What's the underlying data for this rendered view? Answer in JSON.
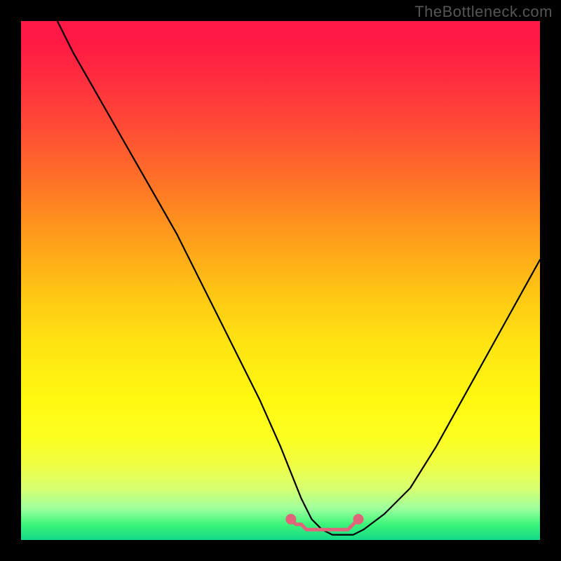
{
  "watermark": "TheBottleneck.com",
  "chart_data": {
    "type": "line",
    "title": "",
    "xlabel": "",
    "ylabel": "",
    "xlim": [
      0,
      100
    ],
    "ylim": [
      0,
      100
    ],
    "note": "Gradient heat background (red high → green low) with a V-shaped black curve. There is a small pink squiggle highlight at the bottom of the V.",
    "series": [
      {
        "name": "curve",
        "x": [
          7,
          10,
          14,
          18,
          22,
          26,
          30,
          34,
          38,
          42,
          46,
          50,
          52,
          54,
          56,
          58,
          60,
          62,
          64,
          66,
          70,
          75,
          80,
          85,
          90,
          95,
          100
        ],
        "values": [
          100,
          94,
          87,
          80,
          73,
          66,
          59,
          51,
          43,
          35,
          27,
          18,
          13,
          8,
          4,
          2,
          1,
          1,
          1,
          2,
          5,
          10,
          18,
          27,
          36,
          45,
          54
        ]
      },
      {
        "name": "highlight-dots",
        "x": [
          52,
          53,
          54,
          55,
          56,
          57,
          58,
          59,
          60,
          61,
          62,
          63,
          64,
          65
        ],
        "values": [
          4,
          3,
          3,
          2,
          2,
          2,
          2,
          2,
          2,
          2,
          2,
          2,
          3,
          4
        ]
      }
    ],
    "gradient_stops": [
      {
        "pos": 0.0,
        "color": "#ff1944"
      },
      {
        "pos": 0.33,
        "color": "#ff7a24"
      },
      {
        "pos": 0.63,
        "color": "#ffe612"
      },
      {
        "pos": 0.85,
        "color": "#f2ff40"
      },
      {
        "pos": 1.0,
        "color": "#14d988"
      }
    ]
  }
}
